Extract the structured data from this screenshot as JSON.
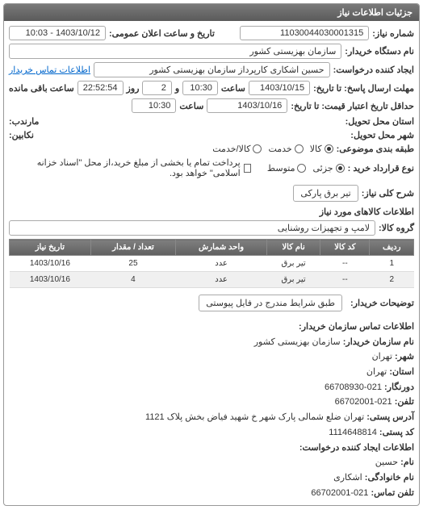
{
  "panel_title": "جزئیات اطلاعات نیاز",
  "labels": {
    "need_no": "شماره نیاز:",
    "announce_time": "تاریخ و ساعت اعلان عمومی:",
    "buyer_org": "نام دستگاه خریدار:",
    "requester": "ایجاد کننده درخواست:",
    "buyer_contact_link": "اطلاعات تماس خریدار",
    "response_deadline": "مهلت ارسال پاسخ: تا تاریخ:",
    "time": "ساعت",
    "and": "و",
    "day": "روز",
    "remaining": "ساعت باقی مانده",
    "validity": "حداقل تاریخ اعتبار قیمت: تا تاریخ:",
    "supply_province": "استان محل تحویل:",
    "supply_city": "شهر محل تحویل:",
    "cabin": "نکابین:",
    "subject_class": "طبقه بندی موضوعی:",
    "goods": "کالا",
    "service": "خدمت",
    "goods_service": "کالا/خدمت",
    "purchase_type": "نوع قرارداد خرید :",
    "partial": "جزئی",
    "medium": "متوسط",
    "payment_note": "پرداخت تمام یا بخشی از مبلغ خرید،از محل \"اسناد خزانه اسلامی\" خواهد بود.",
    "need_title_label": "شرح کلی نیاز:",
    "items_info": "اطلاعات کالاهای مورد نیاز",
    "group_label": "گروه کالا:",
    "buyer_notes": "توضیحات خریدار:",
    "contact_header": "اطلاعات تماس سازمان خریدار:",
    "org_name_l": "نام سازمان خریدار:",
    "city_l": "شهر:",
    "province_l": "استان:",
    "fax_l": "دورنگار:",
    "phone_l": "تلفن:",
    "postal_addr_l": "آدرس پستی:",
    "postal_code_l": "کد پستی:",
    "requester_header": "اطلاعات ایجاد کننده درخواست:",
    "fname_l": "نام:",
    "lname_l": "نام خانوادگی:",
    "contact_phone_l": "تلفن تماس:"
  },
  "values": {
    "need_no": "11030044030001315",
    "announce_time": "1403/10/12 - 10:03",
    "buyer_org": "سازمان بهزیستی کشور",
    "requester": "حسین اشکاری کارپرداز سازمان بهزیستی کشور",
    "resp_date": "1403/10/15",
    "resp_time": "10:30",
    "resp_days": "2",
    "resp_remain": "22:52:54",
    "valid_date": "1403/10/16",
    "valid_time": "10:30",
    "need_title": "تیر برق پارکی",
    "group": "لامپ و تجهیزات روشنایی",
    "buyer_notes": "طبق شرایط مندرج در فایل پیوستی",
    "org_name": "سازمان بهزیستی کشور",
    "city": "تهران",
    "province": "تهران",
    "fax": "021-66708930",
    "phone": "021-66702001",
    "postal_addr": "تهران ضلع شمالی پارک شهر خ شهید فیاض بخش پلاک 1121",
    "postal_code": "1114648814",
    "fname": "حسین",
    "lname": "اشکاری",
    "contact_phone": "021-66702001"
  },
  "table": {
    "headers": [
      "ردیف",
      "کد کالا",
      "نام کالا",
      "واحد شمارش",
      "تعداد / مقدار",
      "تاریخ نیاز"
    ],
    "rows": [
      [
        "1",
        "--",
        "تیر برق",
        "عدد",
        "25",
        "1403/10/16"
      ],
      [
        "2",
        "--",
        "تیر برق",
        "عدد",
        "4",
        "1403/10/16"
      ]
    ]
  }
}
